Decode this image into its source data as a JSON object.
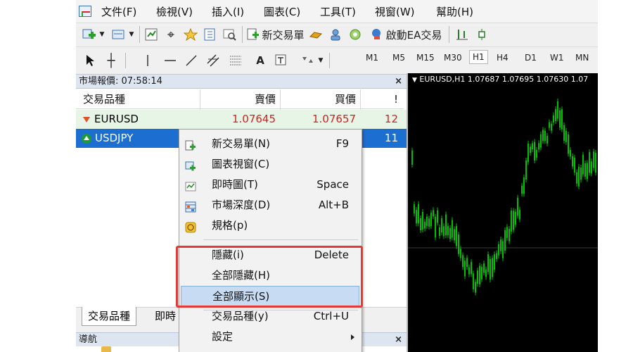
{
  "menubar": {
    "items": [
      "文件(F)",
      "檢視(V)",
      "插入(I)",
      "圖表(C)",
      "工具(T)",
      "視窗(W)",
      "幫助(H)"
    ]
  },
  "toolbar": {
    "new_order_label": "新交易單",
    "autotrade_label": "啟動EA交易",
    "timeframes": [
      "M1",
      "M5",
      "M15",
      "M30",
      "H1",
      "H4",
      "D1",
      "W1",
      "MN"
    ],
    "active_timeframe": "H1",
    "text_tool": "A"
  },
  "market_watch": {
    "title": "市場報價: 07:58:14",
    "close": "×",
    "columns": [
      "交易品種",
      "賣價",
      "買價",
      "!"
    ],
    "rows": [
      {
        "symbol": "EURUSD",
        "bid": "1.07645",
        "ask": "1.07657",
        "spread": "12",
        "trend": "down"
      },
      {
        "symbol": "USDJPY",
        "bid": "",
        "ask": "",
        "spread": "11",
        "trend": "up"
      }
    ],
    "tabs": [
      "交易品種",
      "即時"
    ]
  },
  "navigator": {
    "title": "導航",
    "close": "×"
  },
  "chart": {
    "header": "EURUSD,H1  1.07687 1.07695 1.07630 1.07",
    "colors": {
      "background": "#000000",
      "candles": "#00c000",
      "grid": "#3a3a3a"
    }
  },
  "context_menu": {
    "items": [
      {
        "label": "新交易單(N)",
        "shortcut": "F9",
        "icon": "new-order-icon"
      },
      {
        "label": "圖表視窗(C)",
        "shortcut": "",
        "icon": "chart-window-icon"
      },
      {
        "label": "即時圖(T)",
        "shortcut": "Space",
        "icon": "tick-chart-icon"
      },
      {
        "label": "市場深度(D)",
        "shortcut": "Alt+B",
        "icon": "depth-of-market-icon"
      },
      {
        "label": "規格(p)",
        "shortcut": "",
        "icon": "specification-icon"
      },
      {
        "label": "隱藏(i)",
        "shortcut": "Delete",
        "icon": ""
      },
      {
        "label": "全部隱藏(H)",
        "shortcut": "",
        "icon": ""
      },
      {
        "label": "全部顯示(S)",
        "shortcut": "",
        "icon": "",
        "selected": true
      },
      {
        "label": "交易品種(y)",
        "shortcut": "Ctrl+U",
        "icon": ""
      },
      {
        "label": "設定",
        "shortcut": "",
        "icon": "",
        "submenu": true
      }
    ]
  },
  "highlight_color": "#e53935"
}
